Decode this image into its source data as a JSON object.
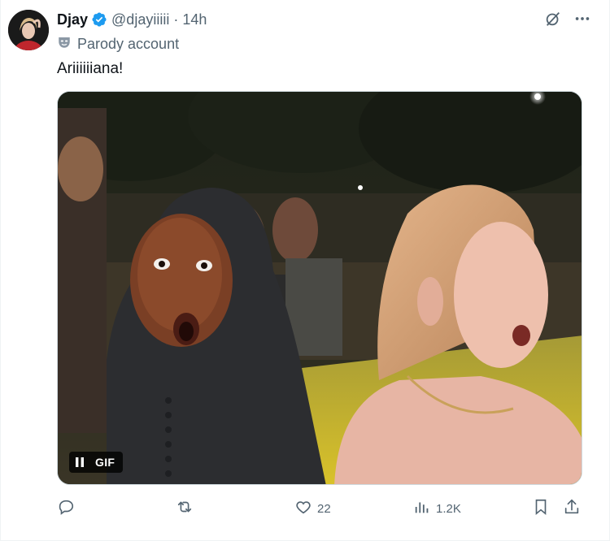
{
  "author": {
    "name": "Djay",
    "handle": "@djayiiiii",
    "separator": "·",
    "time": "14h",
    "verified": true,
    "badge_color": "#1d9bf0"
  },
  "label": {
    "text": "Parody account",
    "icon": "parody-mask-icon"
  },
  "tweet": {
    "text": "Ariiiiiiana!"
  },
  "media": {
    "type_label": "GIF",
    "state": "playing",
    "control_icon": "pause-icon"
  },
  "actions": {
    "reply": {
      "icon": "reply-icon",
      "count": ""
    },
    "retweet": {
      "icon": "retweet-icon",
      "count": ""
    },
    "like": {
      "icon": "heart-icon",
      "count": "22"
    },
    "views": {
      "icon": "views-icon",
      "count": "1.2K"
    },
    "bookmark": {
      "icon": "bookmark-icon"
    },
    "share": {
      "icon": "share-icon"
    }
  },
  "header_actions": {
    "grok": {
      "icon": "grok-icon"
    },
    "more": {
      "icon": "more-icon"
    }
  },
  "colors": {
    "text_primary": "#0f1419",
    "text_secondary": "#536471",
    "verified_blue": "#1d9bf0",
    "border": "#cfd9de"
  }
}
